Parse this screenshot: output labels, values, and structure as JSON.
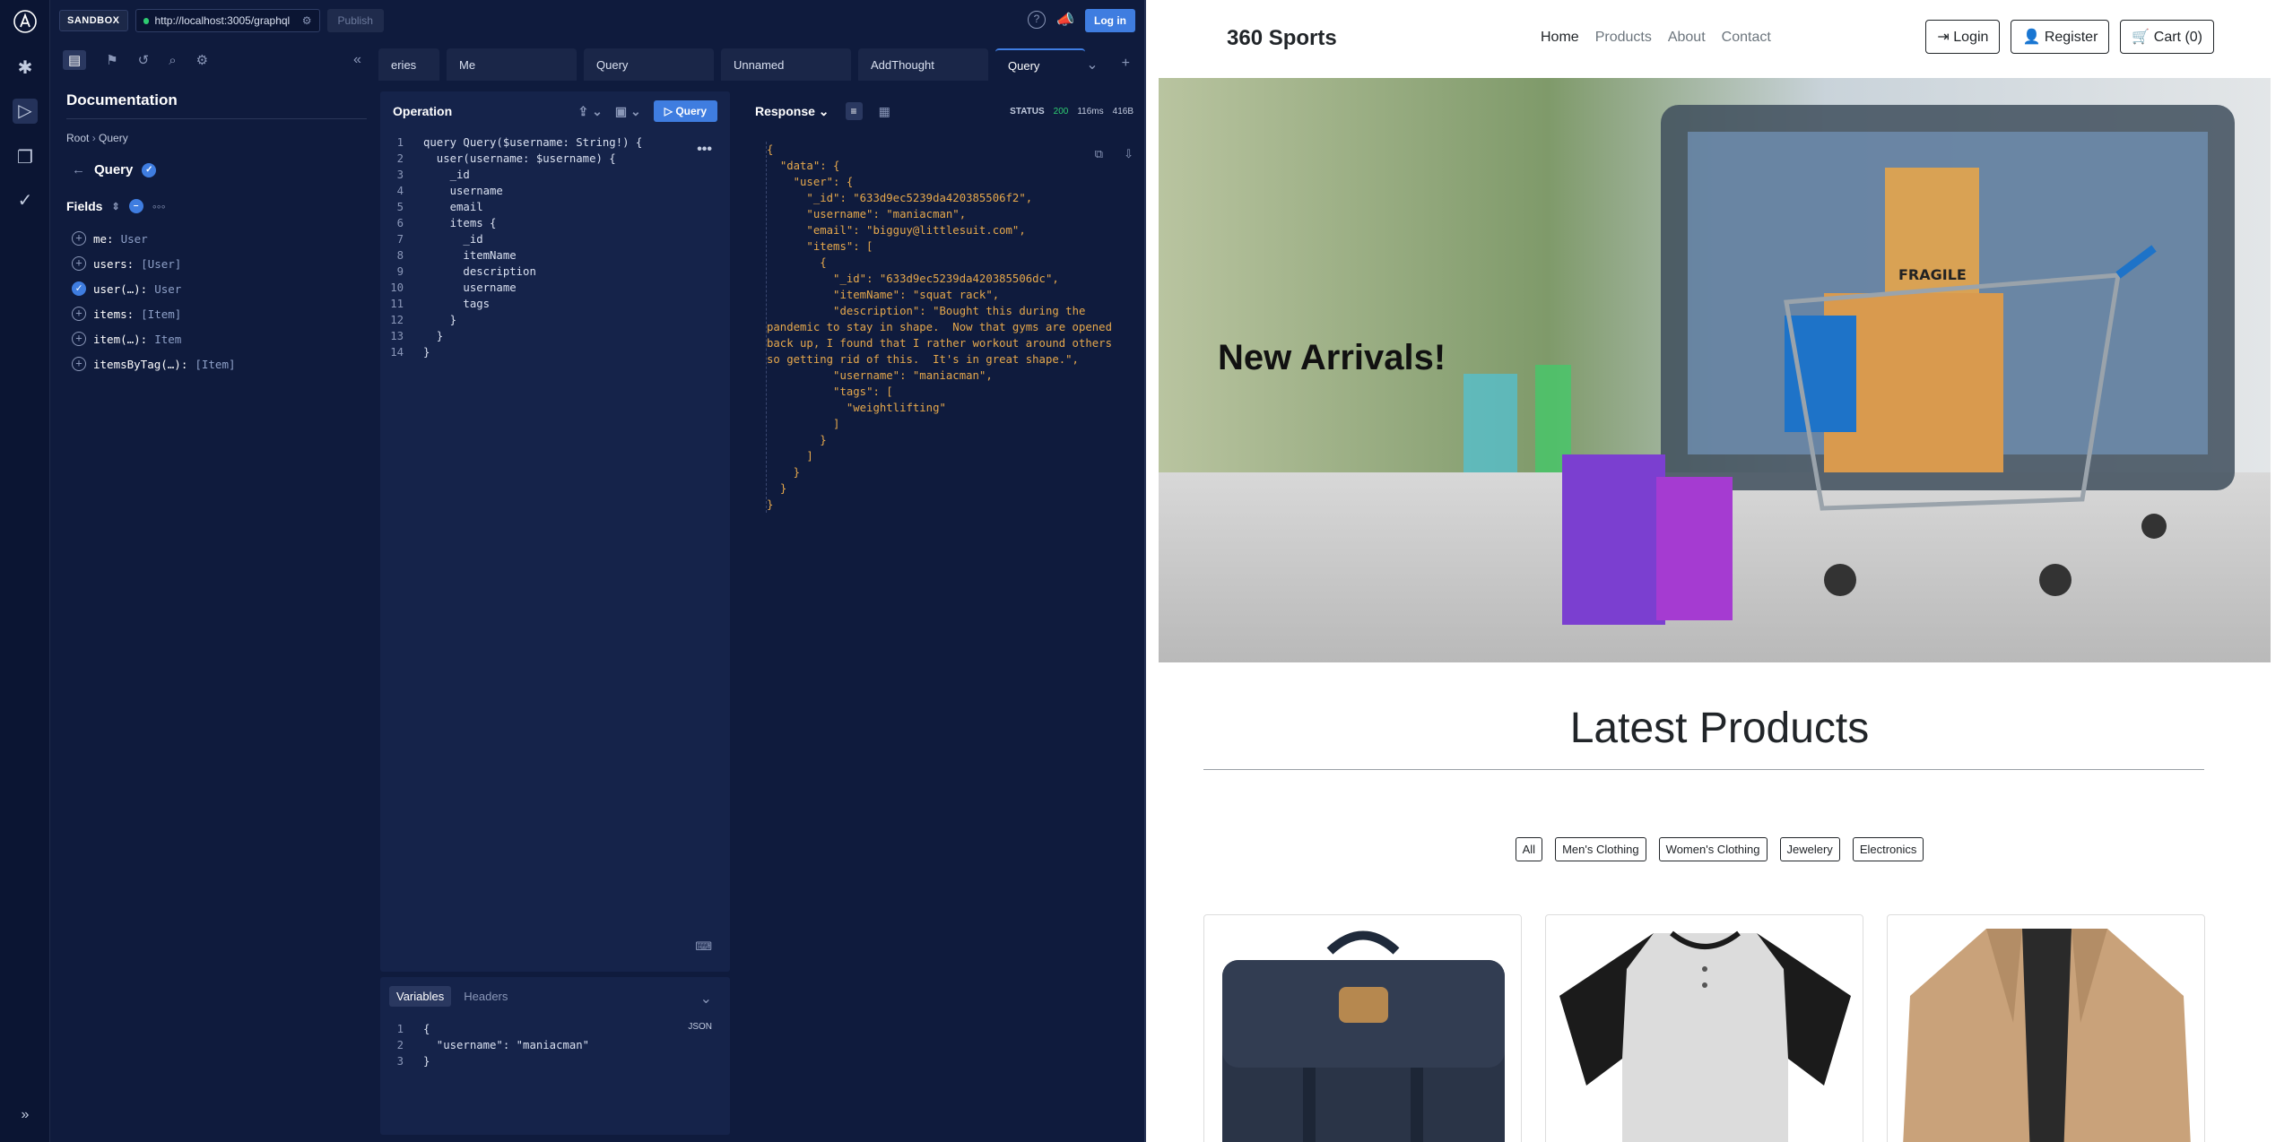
{
  "apollo": {
    "sandbox_label": "SANDBOX",
    "url": "http://localhost:3005/graphql",
    "publish_label": "Publish",
    "login_label": "Log in",
    "docs": {
      "title": "Documentation",
      "breadcrumb_root": "Root",
      "breadcrumb_current": "Query",
      "type_title": "Query",
      "fields_label": "Fields",
      "fields": [
        {
          "name": "me:",
          "type": "User",
          "selected": false
        },
        {
          "name": "users:",
          "type": "[User]",
          "selected": false
        },
        {
          "name": "user(…):",
          "type": "User",
          "selected": true
        },
        {
          "name": "items:",
          "type": "[Item]",
          "selected": false
        },
        {
          "name": "item(…):",
          "type": "Item",
          "selected": false
        },
        {
          "name": "itemsByTag(…):",
          "type": "[Item]",
          "selected": false
        }
      ]
    },
    "tabs": [
      "eries",
      "Me",
      "Query",
      "Unnamed",
      "AddThought",
      "Query"
    ],
    "operation": {
      "title": "Operation",
      "run_label": "Query",
      "lines": [
        "query Query($username: String!) {",
        "  user(username: $username) {",
        "    _id",
        "    username",
        "    email",
        "    items {",
        "      _id",
        "      itemName",
        "      description",
        "      username",
        "      tags",
        "    }",
        "  }",
        "}"
      ]
    },
    "variables": {
      "tab_variables": "Variables",
      "tab_headers": "Headers",
      "format": "JSON",
      "lines": [
        "{",
        "  \"username\": \"maniacman\"",
        "}"
      ]
    },
    "response": {
      "title": "Response",
      "status_label": "STATUS",
      "status_code": "200",
      "time": "116ms",
      "size": "416B",
      "text": "{\n  \"data\": {\n    \"user\": {\n      \"_id\": \"633d9ec5239da420385506f2\",\n      \"username\": \"maniacman\",\n      \"email\": \"bigguy@littlesuit.com\",\n      \"items\": [\n        {\n          \"_id\": \"633d9ec5239da420385506dc\",\n          \"itemName\": \"squat rack\",\n          \"description\": \"Bought this during the pandemic to stay in shape.  Now that gyms are opened back up, I found that I rather workout around others so getting rid of this.  It's in great shape.\",\n          \"username\": \"maniacman\",\n          \"tags\": [\n            \"weightlifting\"\n          ]\n        }\n      ]\n    }\n  }\n}"
    }
  },
  "shop": {
    "brand": "360 Sports",
    "menu": [
      "Home",
      "Products",
      "About",
      "Contact"
    ],
    "login": "Login",
    "register": "Register",
    "cart": "Cart (0)",
    "hero_text": "New Arrivals!",
    "section_title": "Latest Products",
    "filters": [
      "All",
      "Men's Clothing",
      "Women's Clothing",
      "Jewelery",
      "Electronics"
    ],
    "hero_box_label": "FRAGILE"
  }
}
